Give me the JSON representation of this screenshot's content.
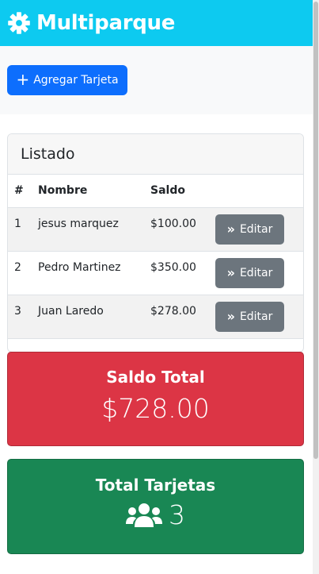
{
  "navbar": {
    "icon": "gear-icon",
    "title": "Multiparque",
    "color": "#0dcaf0"
  },
  "toolbar": {
    "add_label": "Agregar Tarjeta",
    "add_icon": "plus-icon"
  },
  "listado": {
    "title": "Listado",
    "columns": [
      "#",
      "Nombre",
      "Saldo",
      ""
    ],
    "rows": [
      {
        "num": "1",
        "nombre": "jesus marquez",
        "saldo": "$100.00",
        "action": "Editar"
      },
      {
        "num": "2",
        "nombre": "Pedro Martinez",
        "saldo": "$350.00",
        "action": "Editar"
      },
      {
        "num": "3",
        "nombre": "Juan Laredo",
        "saldo": "$278.00",
        "action": "Editar"
      }
    ]
  },
  "saldo_total": {
    "title": "Saldo Total",
    "value": "$728.00",
    "color": "#dc3545"
  },
  "total_tarjetas": {
    "title": "Total Tarjetas",
    "icon": "users-icon",
    "value": "3",
    "color": "#198754"
  }
}
